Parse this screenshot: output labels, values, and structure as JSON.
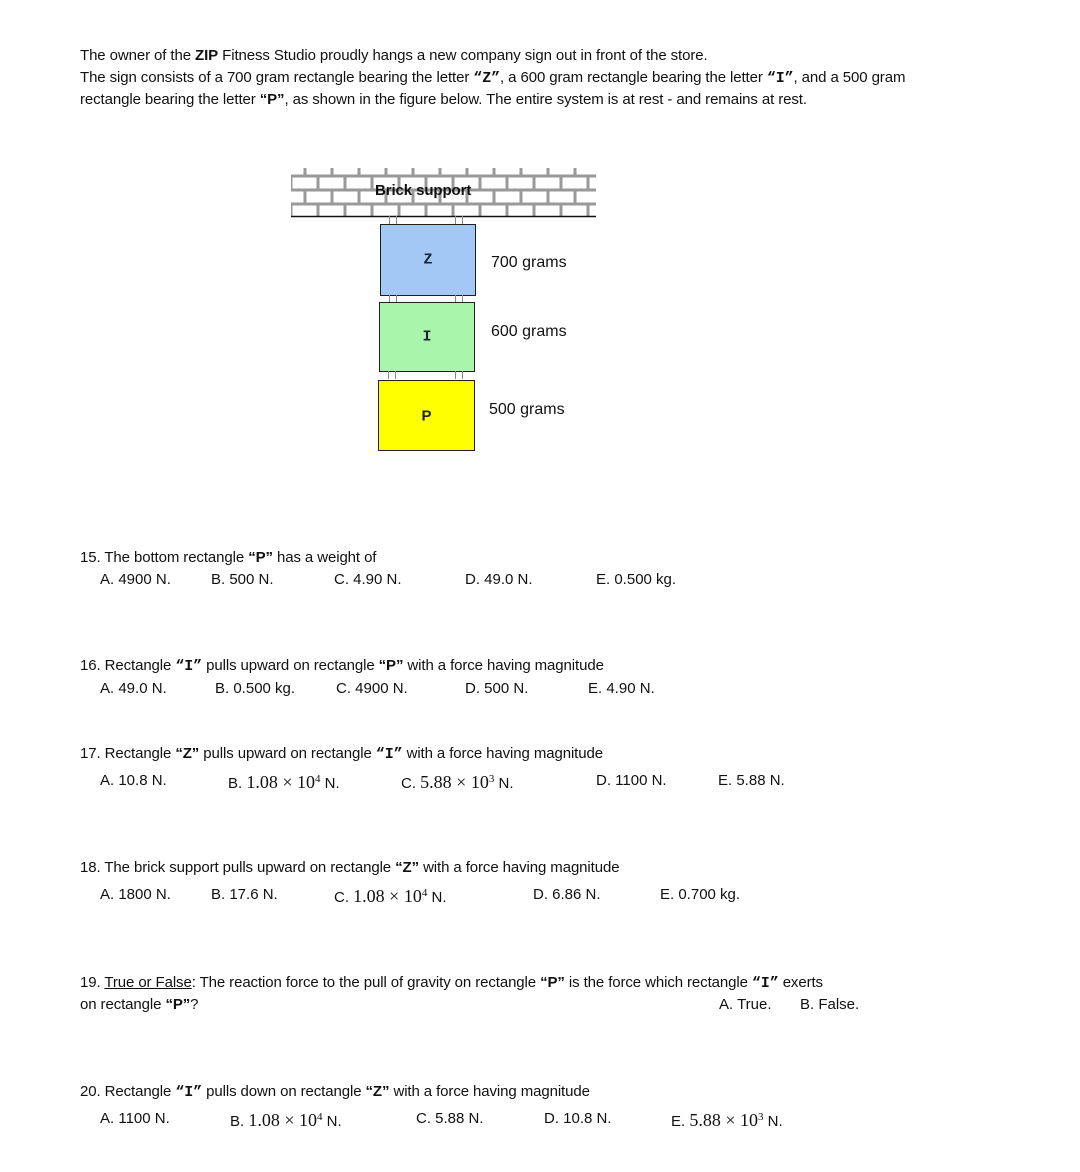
{
  "intro": {
    "line1_pre": "The owner of the ",
    "line1_bold": "ZIP",
    "line1_post": " Fitness Studio proudly hangs a new company sign out in front of the store.",
    "line2_a": "The sign consists of a 700 gram rectangle bearing the letter ",
    "line2_z": "“Z”",
    "line2_b": ",  a 600 gram rectangle bearing the letter ",
    "line2_i": "“I”",
    "line2_c": ", and a 500 gram",
    "line3_a": "rectangle bearing the letter ",
    "line3_p": "“P”",
    "line3_b": ", as shown in the figure below.  The entire system is at rest - and remains at rest."
  },
  "diagram": {
    "support_label": "Brick support",
    "blocks": [
      {
        "letter": "Z",
        "mass": "700 grams",
        "color": "#a4c8f6"
      },
      {
        "letter": "I",
        "mass": "600 grams",
        "color": "#aaf5ac"
      },
      {
        "letter": "P",
        "mass": "500 grams",
        "color": "#ffff00"
      }
    ],
    "brick_color": "#999999"
  },
  "questions": [
    {
      "num": "15.",
      "stem_a": " The bottom rectangle ",
      "stem_q1": "“P”",
      "stem_b": " has a weight of",
      "options": [
        "A.  4900 N.",
        "B.  500 N.",
        "C.  4.90 N.",
        "D.  49.0 N.",
        "E.  0.500 kg."
      ]
    },
    {
      "num": "16.",
      "stem_a": " Rectangle ",
      "stem_q1": "“I”",
      "stem_b": " pulls upward on rectangle ",
      "stem_q2": "“P”",
      "stem_c": " with a force having magnitude",
      "options": [
        "A.  49.0 N.",
        "B.  0.500 kg.",
        "C.  4900 N.",
        "D.  500 N.",
        "E.  4.90 N."
      ]
    },
    {
      "num": "17.",
      "stem_a": " Rectangle ",
      "stem_q1": "“Z”",
      "stem_b": " pulls upward on rectangle ",
      "stem_q2": "“I”",
      "stem_c": " with a force having magnitude",
      "options": [
        {
          "label": "A. 10.8 N."
        },
        {
          "label": "B. ",
          "mant": "1.08 × 10",
          "exp": "4",
          "unit": " N."
        },
        {
          "label": "C. ",
          "mant": "5.88 × 10",
          "exp": "3",
          "unit": " N."
        },
        {
          "label": "D.  1100 N."
        },
        {
          "label": "E.  5.88 N."
        }
      ]
    },
    {
      "num": "18.",
      "stem_a": " The brick support pulls upward on rectangle ",
      "stem_q1": "“Z”",
      "stem_b": " with a force having magnitude",
      "options": [
        {
          "label": "A.  1800 N."
        },
        {
          "label": "B.  17.6 N."
        },
        {
          "label": "C. ",
          "mant": "1.08 × 10",
          "exp": "4",
          "unit": " N."
        },
        {
          "label": "D.  6.86 N."
        },
        {
          "label": "E.  0.700 kg."
        }
      ]
    },
    {
      "num": "19.",
      "tf": "True or False",
      "stem_a": ":  The reaction force to the pull of gravity on rectangle ",
      "stem_q1": "“P”",
      "stem_b": " is the force which rectangle ",
      "stem_q2": "“I”",
      "stem_c": " exerts",
      "stem_d": "on rectangle ",
      "stem_q3": "“P”",
      "stem_e": "?",
      "options": [
        "A. True.",
        "B. False."
      ]
    },
    {
      "num": "20.",
      "stem_a": " Rectangle ",
      "stem_q1": "“I”",
      "stem_b": " pulls down on rectangle ",
      "stem_q2": "“Z”",
      "stem_c": " with a force having magnitude",
      "options": [
        {
          "label": "A.  1100 N."
        },
        {
          "label": "B. ",
          "mant": "1.08 × 10",
          "exp": "4",
          "unit": " N."
        },
        {
          "label": "C.  5.88 N."
        },
        {
          "label": "D. 10.8 N."
        },
        {
          "label": "E. ",
          "mant": "5.88 × 10",
          "exp": "3",
          "unit": " N."
        }
      ]
    }
  ]
}
